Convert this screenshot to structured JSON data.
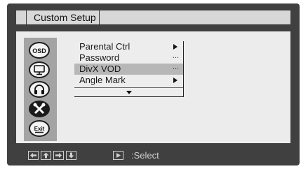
{
  "title": "Custom Setup",
  "sidebar": {
    "icons": [
      {
        "name": "osd-icon",
        "text": "OSD",
        "selected": false
      },
      {
        "name": "monitor-icon",
        "selected": false
      },
      {
        "name": "headphones-icon",
        "selected": false
      },
      {
        "name": "tools-icon",
        "selected": true
      },
      {
        "name": "exit-icon",
        "text": "Exit",
        "selected": false
      }
    ]
  },
  "menu": {
    "items": [
      {
        "label": "Parental Ctrl",
        "indicator": "arrow"
      },
      {
        "label": "Password",
        "indicator": "dots",
        "dots": "..."
      },
      {
        "label": "DivX VOD",
        "indicator": "dots",
        "dots": "...",
        "highlighted": true
      },
      {
        "label": "Angle Mark",
        "indicator": "arrow"
      }
    ]
  },
  "footer": {
    "keys": [
      "left-arrow-icon",
      "up-arrow-icon",
      "right-arrow-icon",
      "down-arrow-icon",
      "play-icon"
    ],
    "select_label": ":Select"
  },
  "colors": {
    "screen_bg": "#404040",
    "panel_bg": "#ececec",
    "icon_column_bg": "#a3a3a3",
    "highlight": "#b7b7b7"
  }
}
